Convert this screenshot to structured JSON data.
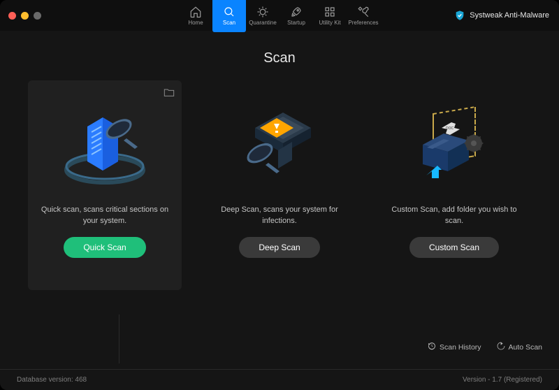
{
  "brand": {
    "name": "Systweak Anti-Malware"
  },
  "nav": {
    "home": "Home",
    "scan": "Scan",
    "quarantine": "Quarantine",
    "startup": "Startup",
    "utility_kit": "Utility Kit",
    "preferences": "Preferences"
  },
  "page": {
    "title": "Scan"
  },
  "cards": {
    "quick": {
      "desc": "Quick scan, scans critical sections on your system.",
      "button": "Quick Scan"
    },
    "deep": {
      "desc": "Deep Scan, scans your system for infections.",
      "button": "Deep Scan"
    },
    "custom": {
      "desc": "Custom Scan, add folder you wish to scan.",
      "button": "Custom Scan"
    }
  },
  "footer": {
    "scan_history": "Scan History",
    "auto_scan": "Auto Scan",
    "db_version": "Database version: 468",
    "app_version": "Version  -  1.7 (Registered)"
  }
}
